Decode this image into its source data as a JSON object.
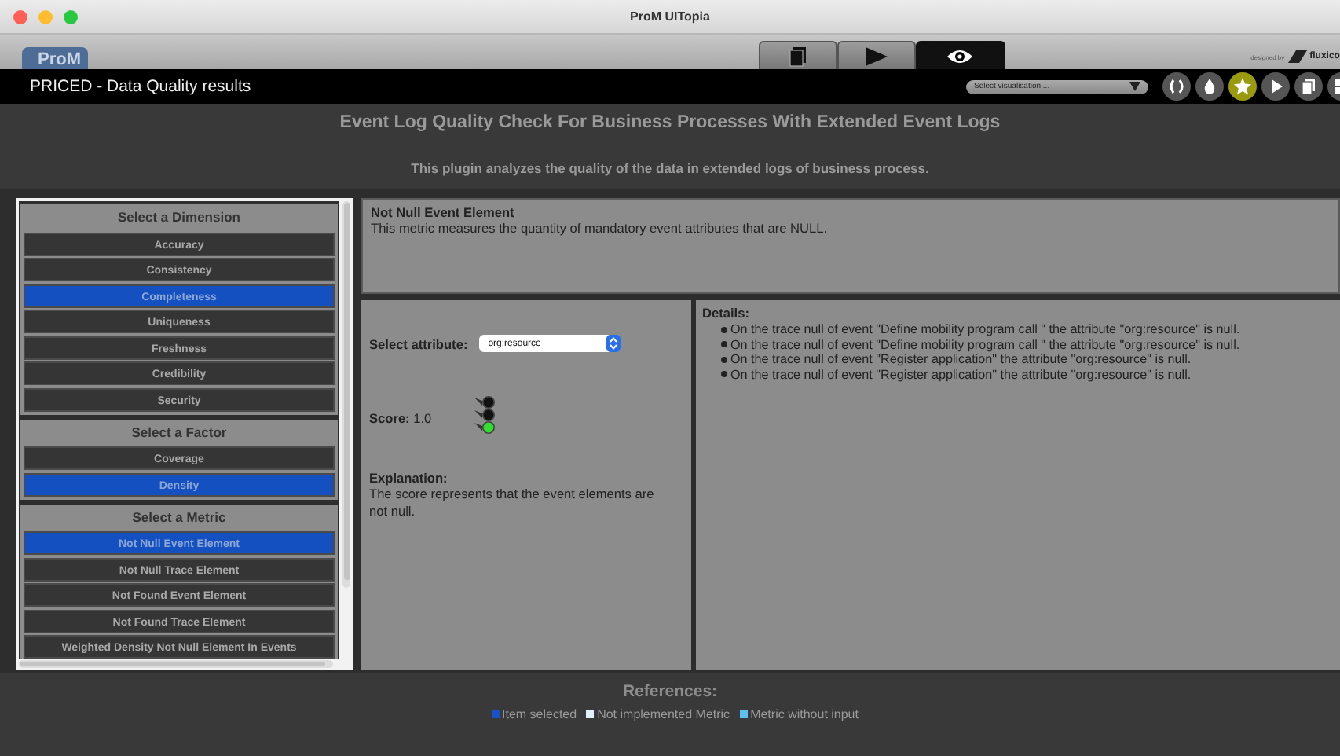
{
  "window": {
    "title": "ProM UITopia"
  },
  "toolbar": {
    "logo": "ProM",
    "tabs": [
      {
        "selected": false
      },
      {
        "selected": false
      },
      {
        "selected": true
      }
    ],
    "credit": "designed by",
    "brand": "fluxico"
  },
  "view_bar": {
    "title": "PRICED - Data Quality results",
    "visualisation": "Select visualisation ...",
    "buttons": [
      {
        "selected": false
      },
      {
        "selected": false
      },
      {
        "selected": true
      },
      {
        "selected": false
      },
      {
        "selected": false
      },
      {
        "selected": false
      }
    ]
  },
  "header": {
    "title": "Event Log Quality Check For Business Processes With Extended Event Logs",
    "subtitle": "This plugin analyzes the quality of the data in extended logs of business process."
  },
  "sidebar": {
    "groups": [
      {
        "title": "Select a Dimension",
        "items": [
          {
            "label": "Accuracy",
            "selected": false
          },
          {
            "label": "Consistency",
            "selected": false
          },
          {
            "label": "Completeness",
            "selected": true
          },
          {
            "label": "Uniqueness",
            "selected": false
          },
          {
            "label": "Freshness",
            "selected": false
          },
          {
            "label": "Credibility",
            "selected": false
          },
          {
            "label": "Security",
            "selected": false
          }
        ]
      },
      {
        "title": "Select a Factor",
        "items": [
          {
            "label": "Coverage",
            "selected": false
          },
          {
            "label": "Density",
            "selected": true
          }
        ]
      },
      {
        "title": "Select a Metric",
        "items": [
          {
            "label": "Not Null Event Element",
            "selected": true
          },
          {
            "label": "Not Null Trace Element",
            "selected": false
          },
          {
            "label": "Not Found Event Element",
            "selected": false
          },
          {
            "label": "Not Found Trace Element",
            "selected": false
          },
          {
            "label": "Weighted Density Not Null Element In Events",
            "selected": false
          }
        ]
      }
    ]
  },
  "metric": {
    "title": "Not Null Event Element",
    "description": "This metric measures the quantity of mandatory event attributes that are NULL."
  },
  "evaluation": {
    "attribute_label": "Select attribute:",
    "attribute": "org:resource",
    "score_label": "Score:",
    "score": "1.0",
    "lights": [
      {
        "on": false
      },
      {
        "on": false
      },
      {
        "on": true
      }
    ],
    "explanation_label": "Explanation:",
    "explanation": "The score represents that the event elements are not null."
  },
  "details": {
    "title": "Details:",
    "items": [
      "On the trace null of event \"Define mobility program call \" the attribute \"org:resource\" is null.",
      "On the trace null of event \"Define mobility program call \" the attribute \"org:resource\" is null.",
      "On the trace null of event \"Register application\" the attribute \"org:resource\" is null.",
      "On the trace null of event \"Register application\" the attribute \"org:resource\" is null."
    ]
  },
  "references": {
    "title": "References:",
    "items": [
      {
        "label": "Item selected",
        "color": "#1a50c8"
      },
      {
        "label": "Not implemented Metric",
        "color": "#e4f0ff"
      },
      {
        "label": "Metric without input",
        "color": "#5cc0f0"
      }
    ]
  }
}
